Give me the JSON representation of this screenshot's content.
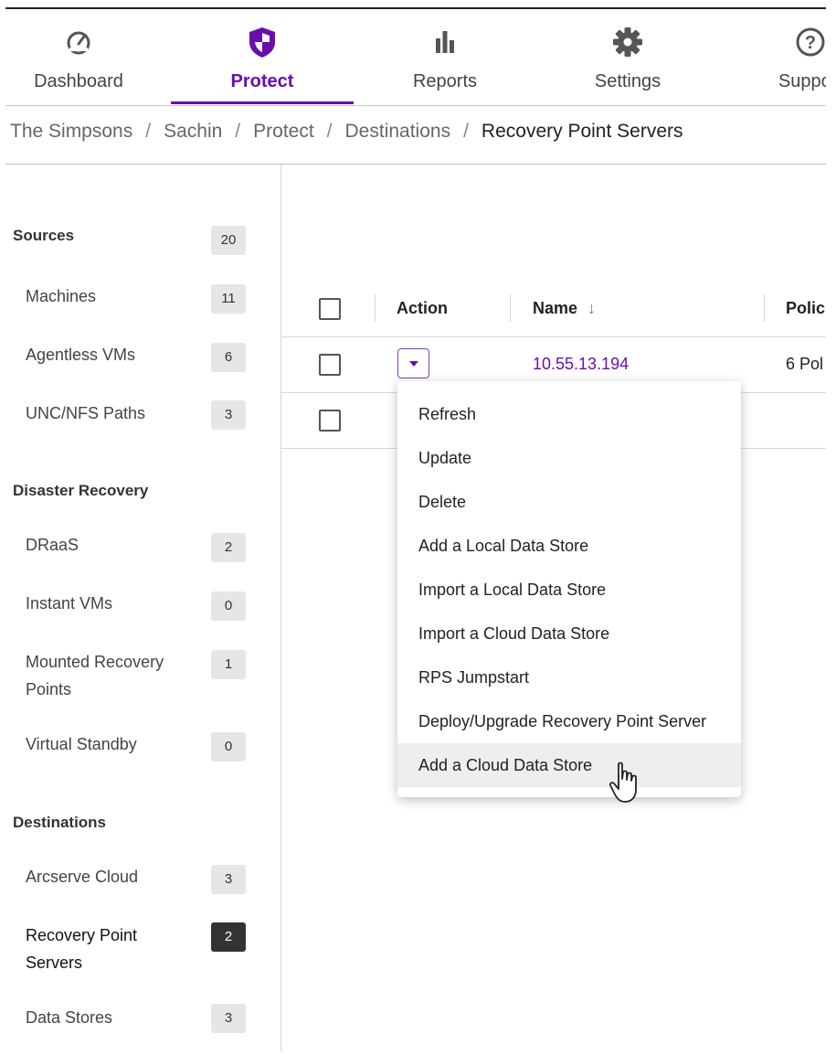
{
  "nav": {
    "items": [
      {
        "label": "Dashboard",
        "icon": "speedometer-icon",
        "active": false
      },
      {
        "label": "Protect",
        "icon": "shield-icon",
        "active": true
      },
      {
        "label": "Reports",
        "icon": "bar-chart-icon",
        "active": false
      },
      {
        "label": "Settings",
        "icon": "gear-icon",
        "active": false
      },
      {
        "label": "Support",
        "icon": "question-icon",
        "active": false
      }
    ]
  },
  "breadcrumb": [
    "The Simpsons",
    "Sachin",
    "Protect",
    "Destinations",
    "Recovery Point Servers"
  ],
  "sidebar": {
    "sources": {
      "title": "Sources",
      "count": "20",
      "items": [
        {
          "label": "Machines",
          "count": "11"
        },
        {
          "label": "Agentless VMs",
          "count": "6"
        },
        {
          "label": "UNC/NFS Paths",
          "count": "3"
        }
      ]
    },
    "disaster_recovery": {
      "title": "Disaster Recovery",
      "items": [
        {
          "label": "DRaaS",
          "count": "2"
        },
        {
          "label": "Instant VMs",
          "count": "0"
        },
        {
          "label": "Mounted Recovery Points",
          "count": "1"
        },
        {
          "label": "Virtual Standby",
          "count": "0"
        }
      ]
    },
    "destinations": {
      "title": "Destinations",
      "items": [
        {
          "label": "Arcserve Cloud",
          "count": "3"
        },
        {
          "label": "Recovery Point Servers",
          "count": "2"
        },
        {
          "label": "Data Stores",
          "count": "3"
        }
      ]
    }
  },
  "table": {
    "headers": {
      "action": "Action",
      "name": "Name",
      "policies": "Polic"
    },
    "rows": [
      {
        "name": "10.55.13.194",
        "policies": "6 Pol"
      },
      {
        "name": "",
        "policies": ""
      }
    ]
  },
  "action_menu": {
    "items": [
      "Refresh",
      "Update",
      "Delete",
      "Add a Local Data Store",
      "Import a Local Data Store",
      "Import a Cloud Data Store",
      "RPS Jumpstart",
      "Deploy/Upgrade Recovery Point Server",
      "Add a Cloud Data Store"
    ]
  },
  "colors": {
    "accent": "#6a0dad",
    "active_badge": "#333333",
    "badge": "#e6e6e6"
  }
}
